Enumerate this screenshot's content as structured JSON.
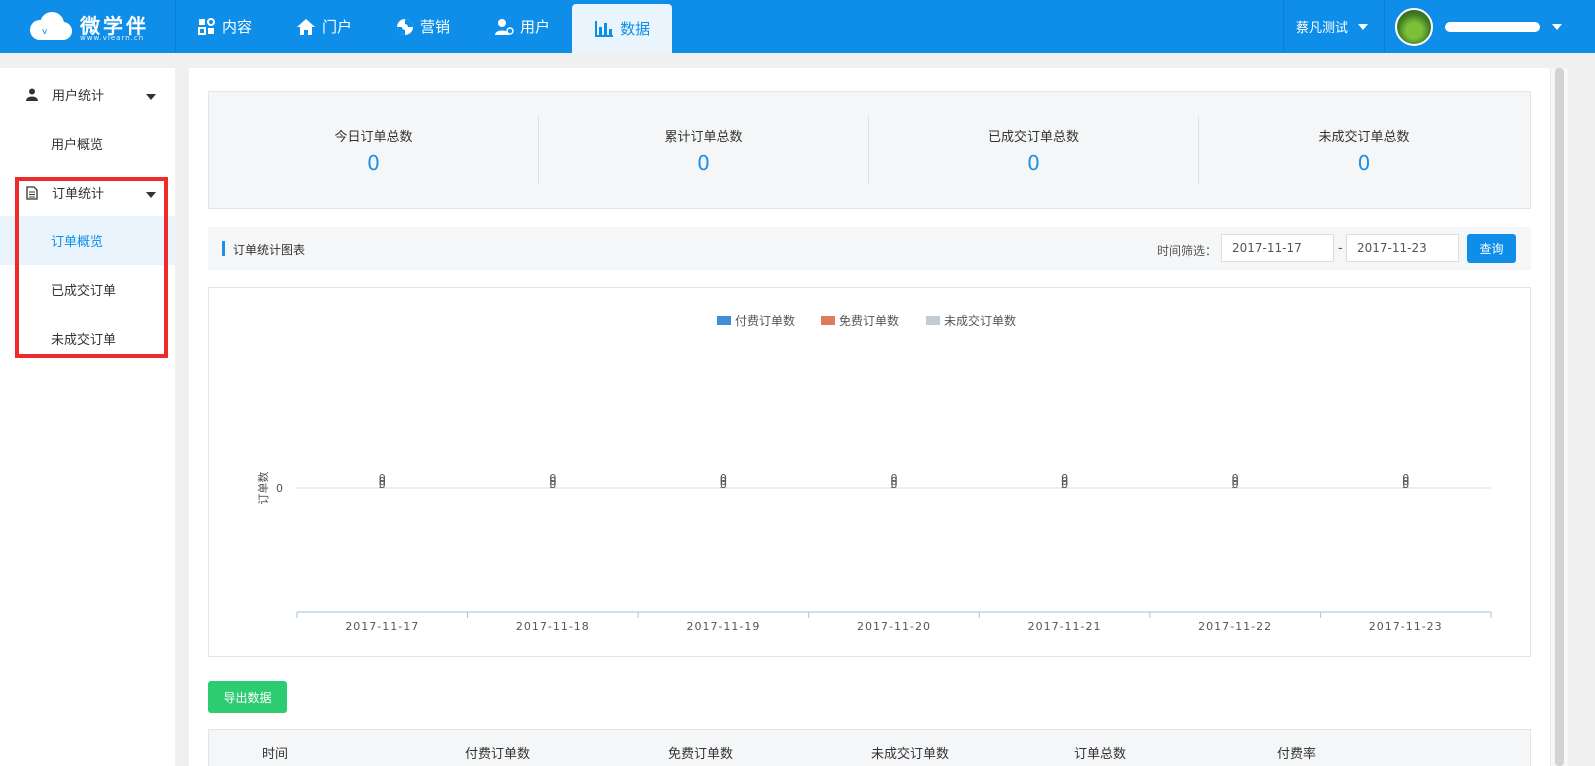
{
  "brand": {
    "name": "微学伴",
    "sub": "www.vlearn.cn"
  },
  "nav": [
    {
      "label": "内容",
      "icon": "content-icon"
    },
    {
      "label": "门户",
      "icon": "home-icon"
    },
    {
      "label": "营销",
      "icon": "marketing-icon"
    },
    {
      "label": "用户",
      "icon": "user-icon"
    },
    {
      "label": "数据",
      "icon": "bar-chart-icon",
      "active": true
    }
  ],
  "tenant": {
    "name": "蔡凡测试"
  },
  "sidebar": {
    "groups": [
      {
        "label": "用户统计",
        "items": [
          {
            "label": "用户概览"
          }
        ]
      },
      {
        "label": "订单统计",
        "items": [
          {
            "label": "订单概览",
            "active": true
          },
          {
            "label": "已成交订单"
          },
          {
            "label": "未成交订单"
          }
        ]
      }
    ]
  },
  "stats": [
    {
      "label": "今日订单总数",
      "value": "0"
    },
    {
      "label": "累计订单总数",
      "value": "0"
    },
    {
      "label": "已成交订单总数",
      "value": "0"
    },
    {
      "label": "未成交订单总数",
      "value": "0"
    }
  ],
  "section": {
    "title": "订单统计图表",
    "filter_label": "时间筛选：",
    "start_date": "2017-11-17",
    "end_date": "2017-11-23",
    "separator": "-",
    "query_label": "查询"
  },
  "chart_data": {
    "type": "bar",
    "categories": [
      "2017-11-17",
      "2017-11-18",
      "2017-11-19",
      "2017-11-20",
      "2017-11-21",
      "2017-11-22",
      "2017-11-23"
    ],
    "series": [
      {
        "name": "付费订单数",
        "color": "#3e8fd8",
        "values": [
          0,
          0,
          0,
          0,
          0,
          0,
          0
        ]
      },
      {
        "name": "免费订单数",
        "color": "#e07a5a",
        "values": [
          0,
          0,
          0,
          0,
          0,
          0,
          0
        ]
      },
      {
        "name": "未成交订单数",
        "color": "#c3cbd3",
        "values": [
          0,
          0,
          0,
          0,
          0,
          0,
          0
        ]
      }
    ],
    "ylabel": "订单数",
    "yticks": [
      "0"
    ],
    "legend": "top-center"
  },
  "export_label": "导出数据",
  "table": {
    "columns": [
      "时间",
      "付费订单数",
      "免费订单数",
      "未成交订单数",
      "订单总数",
      "付费率"
    ]
  }
}
